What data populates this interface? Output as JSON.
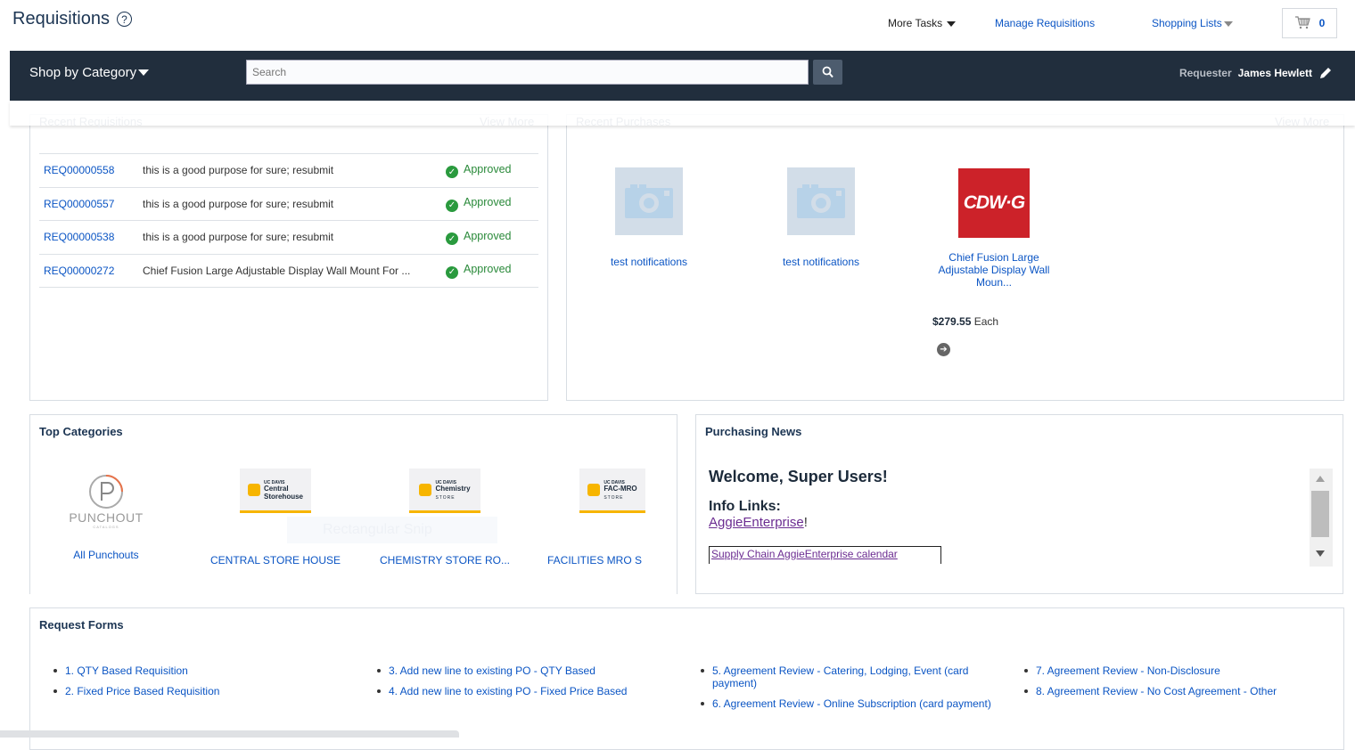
{
  "header": {
    "title": "Requisitions",
    "help_icon": "?",
    "more_tasks": "More Tasks",
    "manage_requisitions": "Manage Requisitions",
    "shopping_lists": "Shopping Lists",
    "cart_count": "0"
  },
  "navbar": {
    "shop_by_category": "Shop by Category",
    "search_placeholder": "Search",
    "requester_label": "Requester",
    "requester_name": "James Hewlett"
  },
  "recent_requisitions": {
    "title": "Recent Requisitions",
    "view_more": "View More",
    "rows": [
      {
        "id": "REQ00000558",
        "description": "this is a good purpose for sure; resubmit",
        "status": "Approved"
      },
      {
        "id": "REQ00000557",
        "description": "this is a good purpose for sure; resubmit",
        "status": "Approved"
      },
      {
        "id": "REQ00000538",
        "description": "this is a good purpose for sure; resubmit",
        "status": "Approved"
      },
      {
        "id": "REQ00000272",
        "description": "Chief Fusion Large Adjustable Display Wall Mount For ...",
        "status": "Approved"
      }
    ]
  },
  "recent_purchases": {
    "title": "Recent Purchases",
    "view_more": "View More",
    "items": [
      {
        "name": "test notifications",
        "image": "camera-placeholder"
      },
      {
        "name": "test notifications",
        "image": "camera-placeholder"
      },
      {
        "name": "Chief Fusion Large Adjustable Display Wall Moun...",
        "image": "CDW·G",
        "price": "$279.55",
        "unit": "Each"
      }
    ]
  },
  "top_categories": {
    "title": "Top Categories",
    "items": [
      {
        "label": "All Punchouts",
        "logo_main": "PUNCHOUT",
        "logo_sub": "CATALOGS"
      },
      {
        "label": "CENTRAL STORE HOUSE",
        "logo_uc": "UC DAVIS",
        "logo_line1": "Central",
        "logo_line2": "Storehouse"
      },
      {
        "label": "CHEMISTRY STORE RO...",
        "logo_uc": "UC DAVIS",
        "logo_line1": "Chemistry",
        "logo_line2": "STORE"
      },
      {
        "label": "FACILITIES MRO S",
        "logo_uc": "UC DAVIS",
        "logo_line1": "FAC-MRO",
        "logo_line2": "STORE"
      }
    ]
  },
  "purchasing_news": {
    "title": "Purchasing News",
    "welcome": "Welcome, Super Users!",
    "info_links": "Info Links:",
    "aggie_link": "AggieEnterprise",
    "aggie_suffix": "!",
    "calendar_link": "Supply Chain AggieEnterprise calendar"
  },
  "request_forms": {
    "title": "Request Forms",
    "columns": [
      [
        "1. QTY Based Requisition",
        "2. Fixed Price Based Requisition"
      ],
      [
        "3. Add new line to existing PO - QTY Based",
        "4. Add new line to existing PO - Fixed Price Based"
      ],
      [
        "5. Agreement Review - Catering, Lodging, Event (card payment)",
        "6. Agreement Review - Online Subscription (card payment)"
      ],
      [
        "7. Agreement Review - Non-Disclosure",
        "8. Agreement Review - No Cost Agreement - Other"
      ]
    ]
  },
  "overlay": {
    "snip_text": "Rectangular Snip"
  }
}
